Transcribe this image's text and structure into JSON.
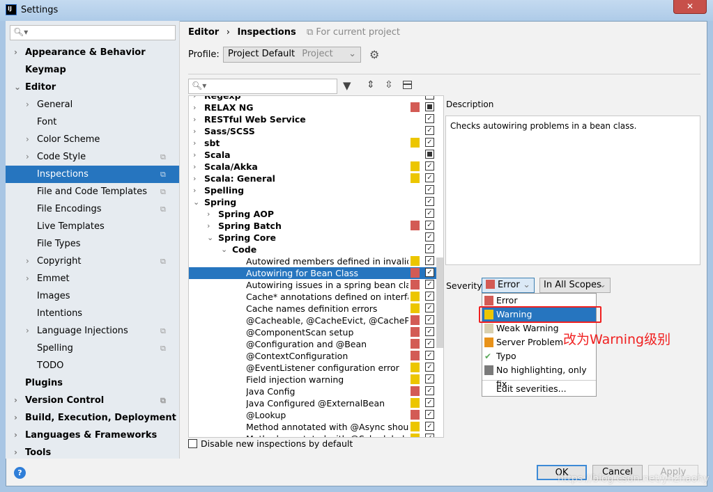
{
  "window": {
    "title": "Settings",
    "close": "✕"
  },
  "sidebar": {
    "search_placeholder": "",
    "items": [
      {
        "label": "Appearance & Behavior",
        "bold": true,
        "chev": "›",
        "indent": 0
      },
      {
        "label": "Keymap",
        "bold": true,
        "chev": "",
        "indent": 0
      },
      {
        "label": "Editor",
        "bold": true,
        "chev": "⌄",
        "indent": 0
      },
      {
        "label": "General",
        "chev": "›",
        "indent": 1
      },
      {
        "label": "Font",
        "chev": "",
        "indent": 1
      },
      {
        "label": "Color Scheme",
        "chev": "›",
        "indent": 1
      },
      {
        "label": "Code Style",
        "chev": "›",
        "indent": 1,
        "project": true
      },
      {
        "label": "Inspections",
        "chev": "",
        "indent": 1,
        "project": true,
        "selected": true
      },
      {
        "label": "File and Code Templates",
        "chev": "",
        "indent": 1,
        "project": true
      },
      {
        "label": "File Encodings",
        "chev": "",
        "indent": 1,
        "project": true
      },
      {
        "label": "Live Templates",
        "chev": "",
        "indent": 1
      },
      {
        "label": "File Types",
        "chev": "",
        "indent": 1
      },
      {
        "label": "Copyright",
        "chev": "›",
        "indent": 1,
        "project": true
      },
      {
        "label": "Emmet",
        "chev": "›",
        "indent": 1
      },
      {
        "label": "Images",
        "chev": "",
        "indent": 1
      },
      {
        "label": "Intentions",
        "chev": "",
        "indent": 1
      },
      {
        "label": "Language Injections",
        "chev": "›",
        "indent": 1,
        "project": true
      },
      {
        "label": "Spelling",
        "chev": "",
        "indent": 1,
        "project": true
      },
      {
        "label": "TODO",
        "chev": "",
        "indent": 1
      },
      {
        "label": "Plugins",
        "bold": true,
        "chev": "",
        "indent": 0
      },
      {
        "label": "Version Control",
        "bold": true,
        "chev": "›",
        "indent": 0,
        "project": true
      },
      {
        "label": "Build, Execution, Deployment",
        "bold": true,
        "chev": "›",
        "indent": 0
      },
      {
        "label": "Languages & Frameworks",
        "bold": true,
        "chev": "›",
        "indent": 0
      },
      {
        "label": "Tools",
        "bold": true,
        "chev": "›",
        "indent": 0
      }
    ]
  },
  "header": {
    "breadcrumb_parent": "Editor",
    "breadcrumb_sep": "›",
    "breadcrumb_current": "Inspections",
    "for_current_project": "For current project"
  },
  "profile": {
    "label": "Profile:",
    "value": "Project Default",
    "scope": "Project"
  },
  "colors": {
    "error": "#d35b55",
    "warning": "#ecc600",
    "weak_warning": "#d9d0b0",
    "server_problem": "#e8921a",
    "no_highlight": "#7a7a7a",
    "selection": "#2675bf",
    "annotation": "#f02020"
  },
  "tree": {
    "rows": [
      {
        "label": "Regexp",
        "bold": true,
        "arrow": "›",
        "level": 0,
        "sev": "",
        "check": "check"
      },
      {
        "label": "RELAX NG",
        "bold": true,
        "arrow": "›",
        "level": 0,
        "sev": "error",
        "check": "mixed"
      },
      {
        "label": "RESTful Web Service",
        "bold": true,
        "arrow": "›",
        "level": 0,
        "sev": "",
        "check": "check"
      },
      {
        "label": "Sass/SCSS",
        "bold": true,
        "arrow": "›",
        "level": 0,
        "sev": "",
        "check": "check"
      },
      {
        "label": "sbt",
        "bold": true,
        "arrow": "›",
        "level": 0,
        "sev": "warning",
        "check": "check"
      },
      {
        "label": "Scala",
        "bold": true,
        "arrow": "›",
        "level": 0,
        "sev": "",
        "check": "mixed"
      },
      {
        "label": "Scala/Akka",
        "bold": true,
        "arrow": "›",
        "level": 0,
        "sev": "warning",
        "check": "check"
      },
      {
        "label": "Scala: General",
        "bold": true,
        "arrow": "›",
        "level": 0,
        "sev": "warning",
        "check": "check"
      },
      {
        "label": "Spelling",
        "bold": true,
        "arrow": "›",
        "level": 0,
        "sev": "",
        "check": "check"
      },
      {
        "label": "Spring",
        "bold": true,
        "arrow": "⌄",
        "level": 0,
        "sev": "",
        "check": "check"
      },
      {
        "label": "Spring AOP",
        "bold": true,
        "arrow": "›",
        "level": 1,
        "sev": "",
        "check": "check"
      },
      {
        "label": "Spring Batch",
        "bold": true,
        "arrow": "›",
        "level": 1,
        "sev": "error",
        "check": "check"
      },
      {
        "label": "Spring Core",
        "bold": true,
        "arrow": "⌄",
        "level": 1,
        "sev": "",
        "check": "check"
      },
      {
        "label": "Code",
        "bold": true,
        "arrow": "⌄",
        "level": 2,
        "sev": "",
        "check": "check"
      },
      {
        "label": "Autowired members defined in invalid S",
        "level": 3,
        "sev": "warning",
        "check": "check"
      },
      {
        "label": "Autowiring for Bean Class",
        "level": 3,
        "sev": "error",
        "check": "check",
        "selected": true
      },
      {
        "label": "Autowiring issues in a spring bean class",
        "level": 3,
        "sev": "error",
        "check": "check"
      },
      {
        "label": "Cache* annotations defined on interface",
        "level": 3,
        "sev": "warning",
        "check": "check"
      },
      {
        "label": "Cache names definition errors",
        "level": 3,
        "sev": "warning",
        "check": "check"
      },
      {
        "label": "@Cacheable, @CacheEvict, @CachePut,",
        "level": 3,
        "sev": "error",
        "check": "check"
      },
      {
        "label": "@ComponentScan setup",
        "level": 3,
        "sev": "error",
        "check": "check"
      },
      {
        "label": "@Configuration and @Bean",
        "level": 3,
        "sev": "error",
        "check": "check"
      },
      {
        "label": "@ContextConfiguration",
        "level": 3,
        "sev": "error",
        "check": "check"
      },
      {
        "label": "@EventListener configuration error",
        "level": 3,
        "sev": "warning",
        "check": "check"
      },
      {
        "label": "Field injection warning",
        "level": 3,
        "sev": "warning",
        "check": "check"
      },
      {
        "label": "Java Config",
        "level": 3,
        "sev": "error",
        "check": "check"
      },
      {
        "label": "Java Configured @ExternalBean",
        "level": 3,
        "sev": "warning",
        "check": "check"
      },
      {
        "label": "@Lookup",
        "level": 3,
        "sev": "error",
        "check": "check"
      },
      {
        "label": "Method annotated with @Async should",
        "level": 3,
        "sev": "warning",
        "check": "check"
      },
      {
        "label": "Method annotated with @Scheduled shoul",
        "level": 3,
        "sev": "warning",
        "check": "check"
      }
    ]
  },
  "disable_new": {
    "label": "Disable new inspections by default",
    "checked": false
  },
  "description": {
    "label": "Description",
    "text": "Checks autowiring problems in a bean class."
  },
  "severity": {
    "label": "Severity:",
    "value": "Error",
    "scope": "In All Scopes",
    "options": [
      {
        "label": "Error",
        "sev": "error"
      },
      {
        "label": "Warning",
        "sev": "warning",
        "selected": true
      },
      {
        "label": "Weak Warning",
        "sev": "weak_warning"
      },
      {
        "label": "Server Problem",
        "sev": "server_problem"
      },
      {
        "label": "Typo",
        "sev": "typo"
      },
      {
        "label": "No highlighting, only fix",
        "sev": "no_highlight"
      }
    ],
    "edit": "Edit severities..."
  },
  "annotation": "改为Warning级别",
  "buttons": {
    "ok": "OK",
    "cancel": "Cancel",
    "apply": "Apply",
    "help": "?"
  },
  "watermark": "https://blog.csdn.net/yhzhaohy"
}
